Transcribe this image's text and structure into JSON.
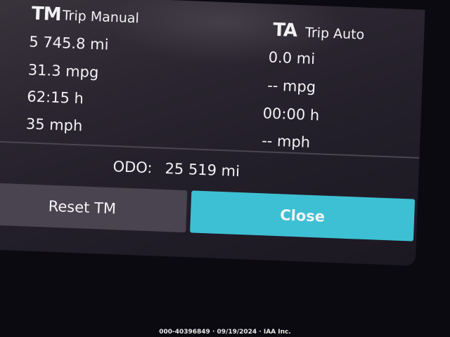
{
  "trip_manual": {
    "abbr": "TM",
    "name": "Trip Manual",
    "distance": "5 745.8 mi",
    "economy": "31.3 mpg",
    "time": "62:15 h",
    "speed": "35 mph"
  },
  "trip_auto": {
    "abbr": "TA",
    "name": "Trip Auto",
    "distance": "0.0 mi",
    "economy": "-- mpg",
    "time": "00:00 h",
    "speed": "-- mph"
  },
  "odometer": {
    "label": "ODO:",
    "value": "25 519 mi"
  },
  "buttons": {
    "reset_label": "Reset TM",
    "close_label": "Close"
  },
  "footer": {
    "watermark": "000-40396849 · 09/19/2024 · IAA Inc."
  },
  "colors": {
    "close_accent": "#3dc0d3",
    "reset_bg": "#4a4450",
    "screen_bg": "#2a2530"
  }
}
